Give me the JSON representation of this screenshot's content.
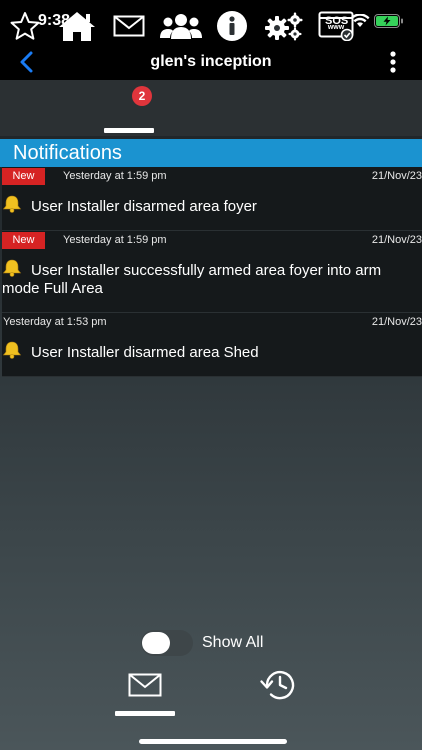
{
  "status_bar": {
    "time": "9:38",
    "sos": "SOS"
  },
  "nav": {
    "title": "glen's inception"
  },
  "toolbar": {
    "mail_badge": "2",
    "icons": [
      "star-icon",
      "home-icon",
      "mail-icon",
      "users-icon",
      "info-icon",
      "settings-icon",
      "web-icon"
    ]
  },
  "section": {
    "title": "Notifications"
  },
  "notifications": [
    {
      "new_label": "New",
      "time": "Yesterday at 1:59 pm",
      "date": "21/Nov/23",
      "message": "User Installer disarmed area foyer"
    },
    {
      "new_label": "New",
      "time": "Yesterday at 1:59 pm",
      "date": "21/Nov/23",
      "message": "User Installer successfully armed area foyer into arm mode Full Area"
    },
    {
      "new_label": "",
      "time": "Yesterday at 1:53 pm",
      "date": "21/Nov/23",
      "message": "User Installer disarmed area Shed"
    }
  ],
  "filter": {
    "show_all_label": "Show All",
    "show_all_on": false
  },
  "bottom_tabs": [
    "mail-icon",
    "history-icon"
  ],
  "colors": {
    "accent": "#1b93d0",
    "new_badge": "#d62323",
    "back_arrow": "#1a7cf5",
    "bell": "#f0c020"
  }
}
